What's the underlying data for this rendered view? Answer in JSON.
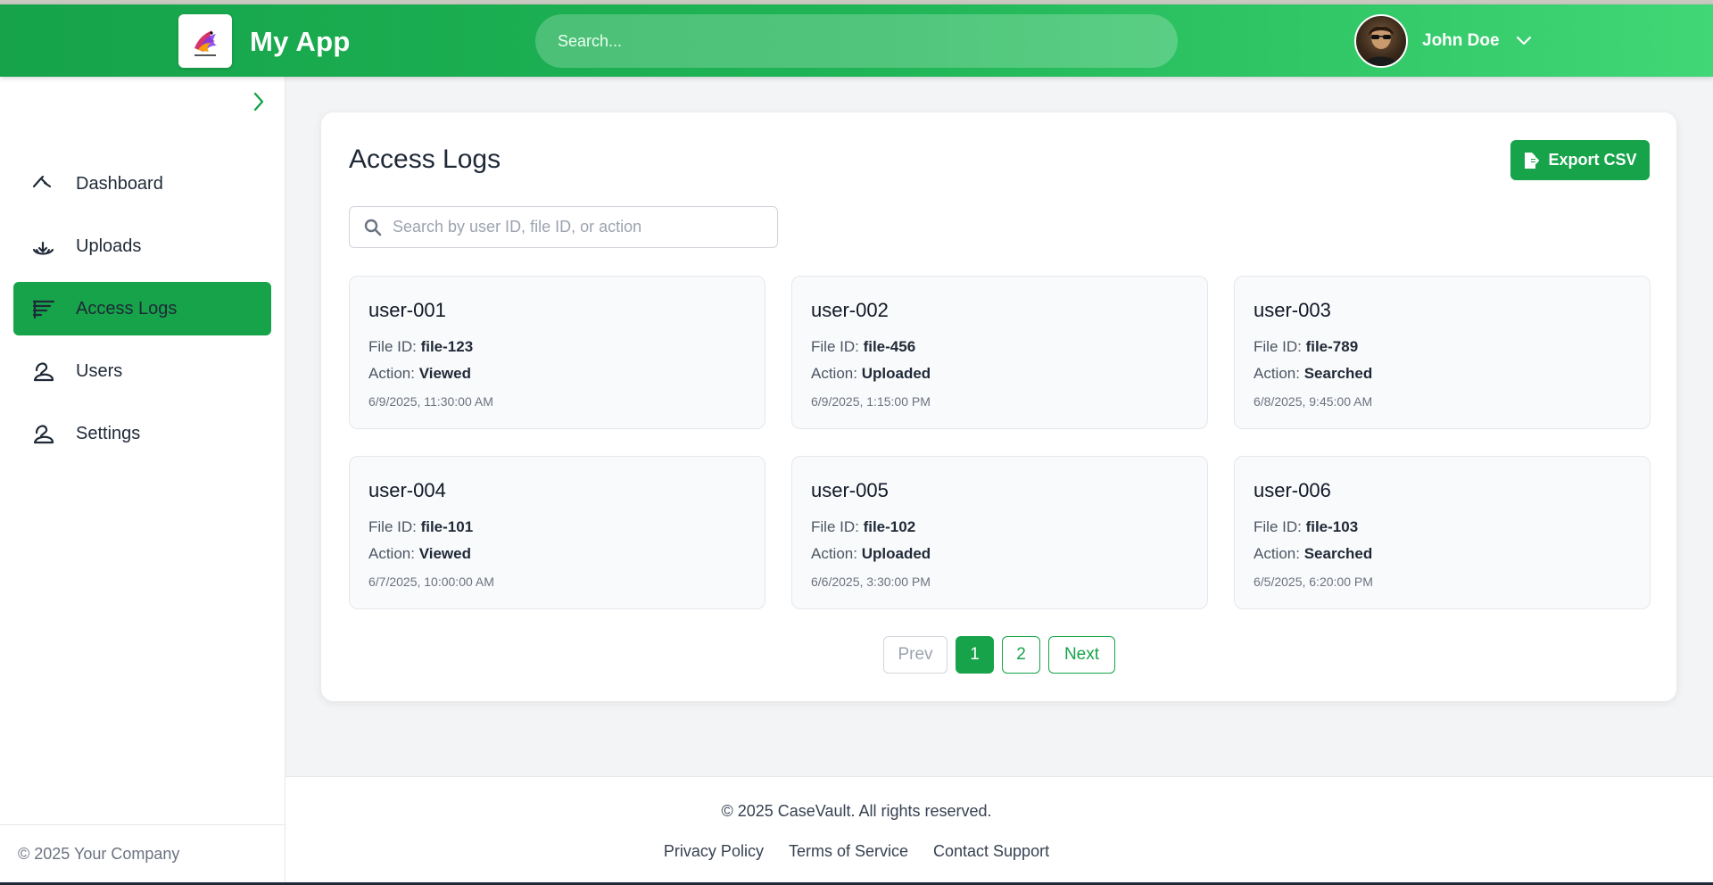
{
  "header": {
    "app_title": "My App",
    "search_placeholder": "Search...",
    "user_name": "John Doe"
  },
  "sidebar": {
    "items": [
      {
        "label": "Dashboard",
        "icon": "dashboard-icon",
        "active": false
      },
      {
        "label": "Uploads",
        "icon": "uploads-icon",
        "active": false
      },
      {
        "label": "Access Logs",
        "icon": "access-logs-icon",
        "active": true
      },
      {
        "label": "Users",
        "icon": "users-icon",
        "active": false
      },
      {
        "label": "Settings",
        "icon": "settings-icon",
        "active": false
      }
    ],
    "footer": "© 2025 Your Company"
  },
  "main": {
    "title": "Access Logs",
    "export_label": "Export CSV",
    "search_placeholder": "Search by user ID, file ID, or action",
    "file_id_label": "File ID:",
    "action_label": "Action:",
    "logs": [
      {
        "user": "user-001",
        "file_id": "file-123",
        "action": "Viewed",
        "time": "6/9/2025, 11:30:00 AM"
      },
      {
        "user": "user-002",
        "file_id": "file-456",
        "action": "Uploaded",
        "time": "6/9/2025, 1:15:00 PM"
      },
      {
        "user": "user-003",
        "file_id": "file-789",
        "action": "Searched",
        "time": "6/8/2025, 9:45:00 AM"
      },
      {
        "user": "user-004",
        "file_id": "file-101",
        "action": "Viewed",
        "time": "6/7/2025, 10:00:00 AM"
      },
      {
        "user": "user-005",
        "file_id": "file-102",
        "action": "Uploaded",
        "time": "6/6/2025, 3:30:00 PM"
      },
      {
        "user": "user-006",
        "file_id": "file-103",
        "action": "Searched",
        "time": "6/5/2025, 6:20:00 PM"
      }
    ],
    "pagination": {
      "prev": "Prev",
      "pages": [
        "1",
        "2"
      ],
      "current": "1",
      "next": "Next"
    }
  },
  "footer": {
    "copyright": "© 2025 CaseVault. All rights reserved.",
    "links": [
      "Privacy Policy",
      "Terms of Service",
      "Contact Support"
    ]
  },
  "colors": {
    "primary": "#16a34a",
    "header_gradient_end": "#41d776",
    "background": "#f3f4f6"
  }
}
